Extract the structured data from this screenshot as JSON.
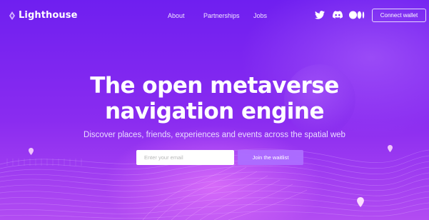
{
  "brand": {
    "name": "Lighthouse",
    "icon": "lighthouse-logo-icon"
  },
  "nav": {
    "links": [
      "About",
      "Partnerships",
      "Jobs"
    ]
  },
  "social": [
    {
      "icon": "twitter-icon"
    },
    {
      "icon": "discord-icon"
    },
    {
      "icon": "medium-icon"
    }
  ],
  "header": {
    "connect_label": "Connect wallet"
  },
  "hero": {
    "title_line1": "The open metaverse",
    "title_line2": "navigation engine",
    "subtitle": "Discover places, friends, experiences and events across the spatial web",
    "email_placeholder": "Enter your email",
    "waitlist_label": "Join the waitlist"
  },
  "colors": {
    "background": "#7b2ff0",
    "accent_button": "#ac6eff",
    "text": "#ffffff"
  }
}
